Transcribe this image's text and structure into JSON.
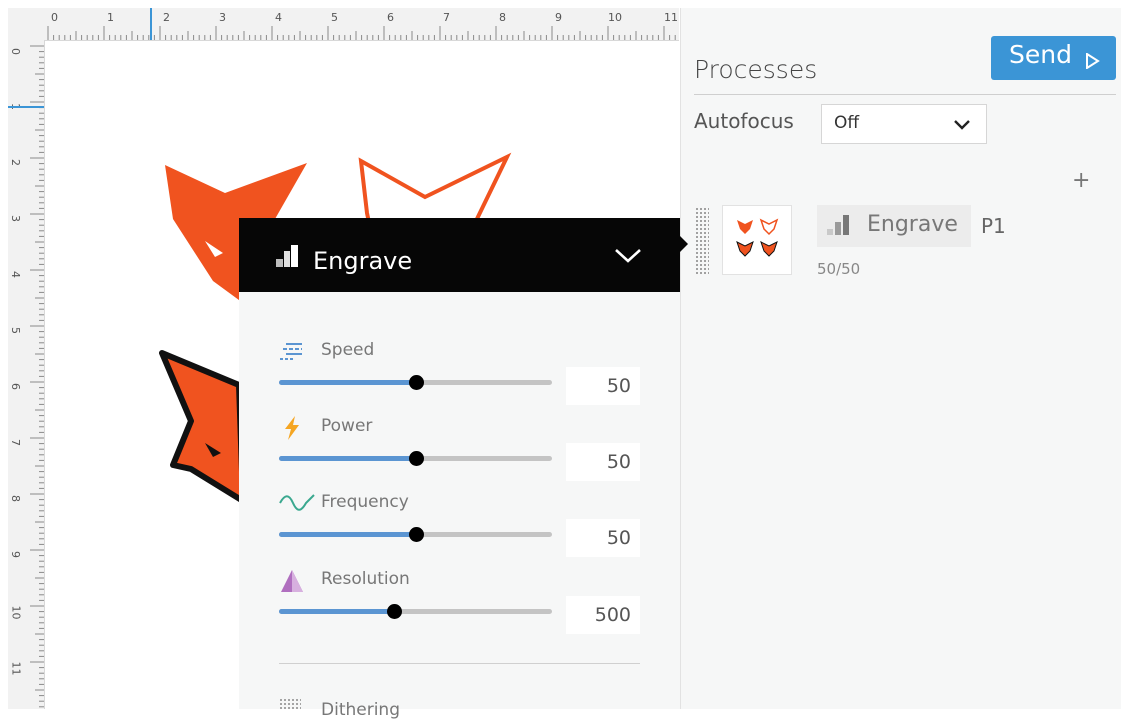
{
  "rulers": {
    "top_numbers": [
      "0",
      "1",
      "2",
      "3",
      "4",
      "5",
      "6",
      "7",
      "8",
      "9",
      "10",
      "11"
    ],
    "left_numbers": [
      "0",
      "1",
      "2",
      "3",
      "4",
      "5",
      "6",
      "7",
      "8",
      "9",
      "10",
      "11"
    ]
  },
  "processes": {
    "title": "Processes",
    "send_label": "Send",
    "autofocus_label": "Autofocus",
    "autofocus_value": "Off",
    "add_symbol": "+",
    "item": {
      "label": "Engrave",
      "tag": "P1",
      "progress": "50/50"
    }
  },
  "engrave_popup": {
    "title": "Engrave",
    "sliders": [
      {
        "label": "Speed",
        "value": "50",
        "fraction": 0.5
      },
      {
        "label": "Power",
        "value": "50",
        "fraction": 0.5
      },
      {
        "label": "Frequency",
        "value": "50",
        "fraction": 0.5
      },
      {
        "label": "Resolution",
        "value": "500",
        "fraction": 0.42
      }
    ],
    "next_section": "Dithering"
  },
  "colors": {
    "accent": "#3b95d6",
    "fox_orange": "#f0531f",
    "slider_fill": "#5b95d2"
  },
  "icons": [
    "send-play-icon",
    "chevron-down-icon",
    "engrave-icon",
    "speed-icon",
    "power-icon",
    "frequency-icon",
    "resolution-icon",
    "dithering-icon",
    "plus-icon",
    "drag-handle-icon"
  ]
}
